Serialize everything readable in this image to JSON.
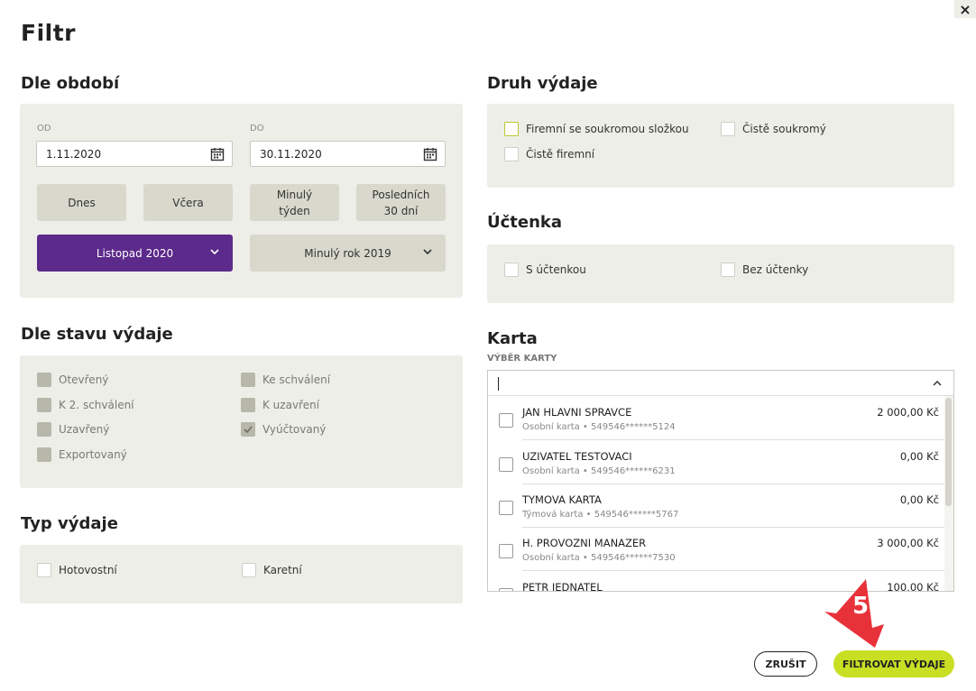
{
  "dialog": {
    "title": "Filtr",
    "close_label": "×"
  },
  "period": {
    "title": "Dle období",
    "from_label": "OD",
    "from_value": "1.11.2020",
    "to_label": "DO",
    "to_value": "30.11.2020",
    "quick": [
      {
        "label": "Dnes"
      },
      {
        "label": "Včera"
      },
      {
        "label": "Minulý týden"
      },
      {
        "label": "Posledních 30 dní"
      }
    ],
    "month_select": "Listopad 2020",
    "year_select": "Minulý rok 2019"
  },
  "status": {
    "title": "Dle stavu výdaje",
    "items": [
      {
        "label": "Otevřený",
        "checked": false
      },
      {
        "label": "Ke schválení",
        "checked": false
      },
      {
        "label": "K 2. schválení",
        "checked": false
      },
      {
        "label": "K uzavření",
        "checked": false
      },
      {
        "label": "Uzavřený",
        "checked": false
      },
      {
        "label": "Vyúčtovaný",
        "checked": true
      },
      {
        "label": "Exportovaný",
        "checked": false
      }
    ]
  },
  "type": {
    "title": "Typ výdaje",
    "items": [
      {
        "label": "Hotovostní"
      },
      {
        "label": "Karetní"
      }
    ]
  },
  "kind": {
    "title": "Druh výdaje",
    "items": [
      {
        "label": "Firemní se soukromou složkou"
      },
      {
        "label": "Čistě soukromý"
      },
      {
        "label": "Čistě firemní"
      }
    ]
  },
  "receipt": {
    "title": "Účtenka",
    "items": [
      {
        "label": "S účtenkou"
      },
      {
        "label": "Bez účtenky"
      }
    ]
  },
  "card": {
    "title": "Karta",
    "select_label": "VÝBĚR KARTY",
    "rows": [
      {
        "name": "JAN HLAVNI SPRAVCE",
        "sub": "Osobní karta • 549546******5124",
        "amount": "2 000,00 Kč"
      },
      {
        "name": "UZIVATEL TESTOVACI",
        "sub": "Osobní karta • 549546******6231",
        "amount": "0,00 Kč"
      },
      {
        "name": "TYMOVA KARTA",
        "sub": "Týmová karta • 549546******5767",
        "amount": "0,00 Kč"
      },
      {
        "name": "H. PROVOZNI MANAZER",
        "sub": "Osobní karta • 549546******7530",
        "amount": "3 000,00 Kč"
      },
      {
        "name": "PETR JEDNATEL",
        "sub": "",
        "amount": "100,00 Kč"
      }
    ]
  },
  "annotation": {
    "number": "5"
  },
  "actions": {
    "cancel": "ZRUŠIT",
    "submit": "FILTROVAT VÝDAJE"
  },
  "colors": {
    "accent": "#c9df23",
    "purple": "#5c2a8a",
    "panel": "#eeeee8",
    "marker": "#e8323a"
  }
}
